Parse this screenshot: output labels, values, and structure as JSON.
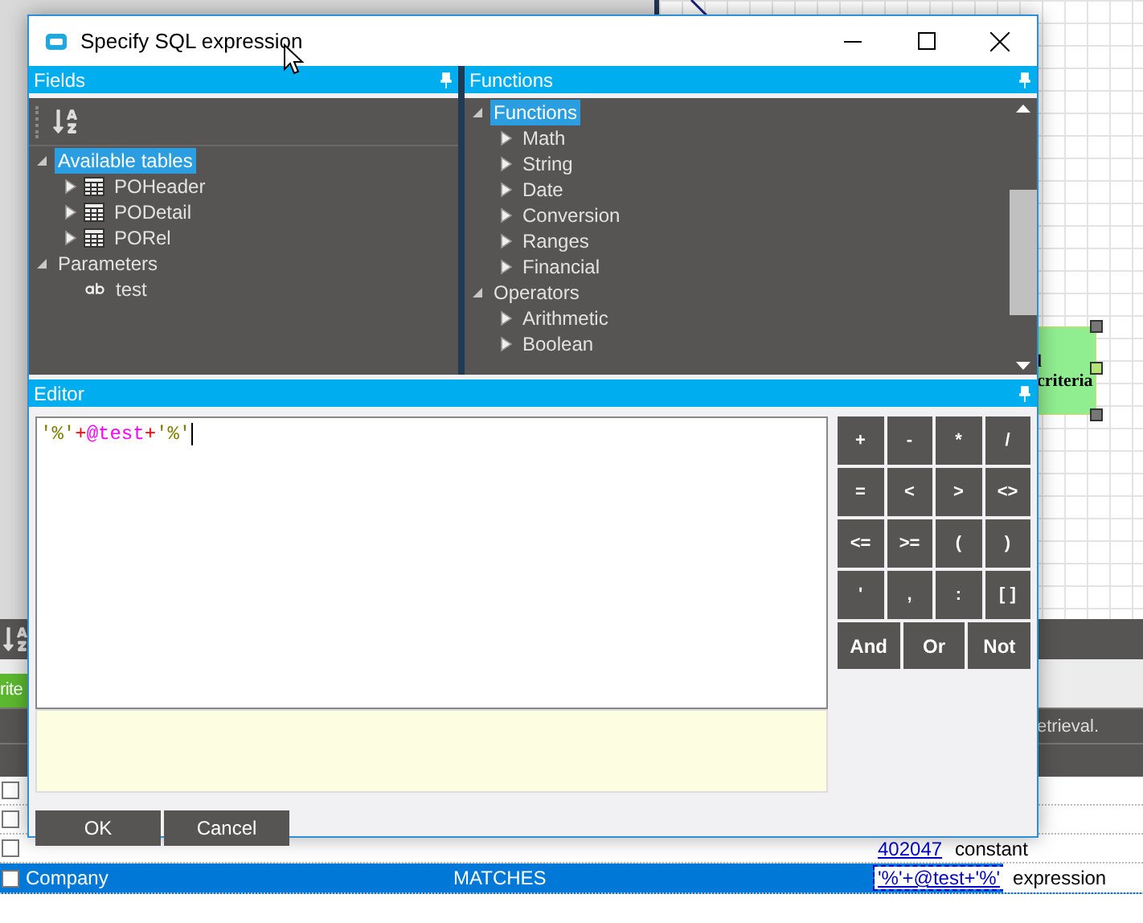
{
  "background": {
    "node": {
      "lines": [
        "l",
        "criteria"
      ]
    },
    "tab": {
      "label": "rite"
    },
    "note": "etrieval.",
    "rows": [
      {
        "checked": false,
        "selected": false,
        "field": "",
        "operator": "",
        "value": "",
        "value_kind": ""
      },
      {
        "checked": false,
        "selected": false,
        "field": "",
        "operator": "",
        "value": "",
        "value_kind": ""
      },
      {
        "checked": false,
        "selected": false,
        "field": "",
        "operator": "",
        "value": "402047",
        "value_kind": "constant"
      },
      {
        "checked": false,
        "selected": true,
        "field": "Company",
        "operator": "MATCHES",
        "value": "'%'+@test+'%'",
        "value_kind": "expression"
      }
    ]
  },
  "dialog": {
    "title": "Specify SQL expression",
    "fields_panel": {
      "title": "Fields",
      "tree": [
        {
          "label": "Available tables",
          "expanded": true,
          "selected": true,
          "children": [
            {
              "label": "POHeader",
              "kind": "table",
              "expanded": false,
              "selected": false
            },
            {
              "label": "PODetail",
              "kind": "table",
              "expanded": false,
              "selected": false
            },
            {
              "label": "PORel",
              "kind": "table",
              "expanded": false,
              "selected": false
            }
          ]
        },
        {
          "label": "Parameters",
          "expanded": true,
          "selected": false,
          "children": [
            {
              "label": "test",
              "kind": "parameter",
              "selected": false
            }
          ]
        }
      ]
    },
    "functions_panel": {
      "title": "Functions",
      "tree": [
        {
          "label": "Functions",
          "expanded": true,
          "selected": true,
          "children": [
            {
              "label": "Math",
              "expanded": false,
              "selected": false
            },
            {
              "label": "String",
              "expanded": false,
              "selected": false
            },
            {
              "label": "Date",
              "expanded": false,
              "selected": false
            },
            {
              "label": "Conversion",
              "expanded": false,
              "selected": false
            },
            {
              "label": "Ranges",
              "expanded": false,
              "selected": false
            },
            {
              "label": "Financial",
              "expanded": false,
              "selected": false
            }
          ]
        },
        {
          "label": "Operators",
          "expanded": true,
          "selected": false,
          "children": [
            {
              "label": "Arithmetic",
              "expanded": false,
              "selected": false
            },
            {
              "label": "Boolean",
              "expanded": false,
              "selected": false
            }
          ]
        }
      ]
    },
    "editor": {
      "title": "Editor",
      "tokens": [
        {
          "text": "'%'",
          "color": "#808000"
        },
        {
          "text": "+",
          "color": "#ff0000"
        },
        {
          "text": "@test",
          "color": "#ff00ff"
        },
        {
          "text": "+",
          "color": "#ff0000"
        },
        {
          "text": "'%'",
          "color": "#808000"
        }
      ]
    },
    "operator_keys": [
      [
        "+",
        "-",
        "*",
        "/"
      ],
      [
        "=",
        "<",
        ">",
        "<>"
      ],
      [
        "<=",
        ">=",
        "(",
        ")"
      ],
      [
        "'",
        ",",
        ":",
        "[ ]"
      ]
    ],
    "logic_keys": [
      "And",
      "Or",
      "Not"
    ],
    "buttons": [
      "OK",
      "Cancel"
    ]
  }
}
